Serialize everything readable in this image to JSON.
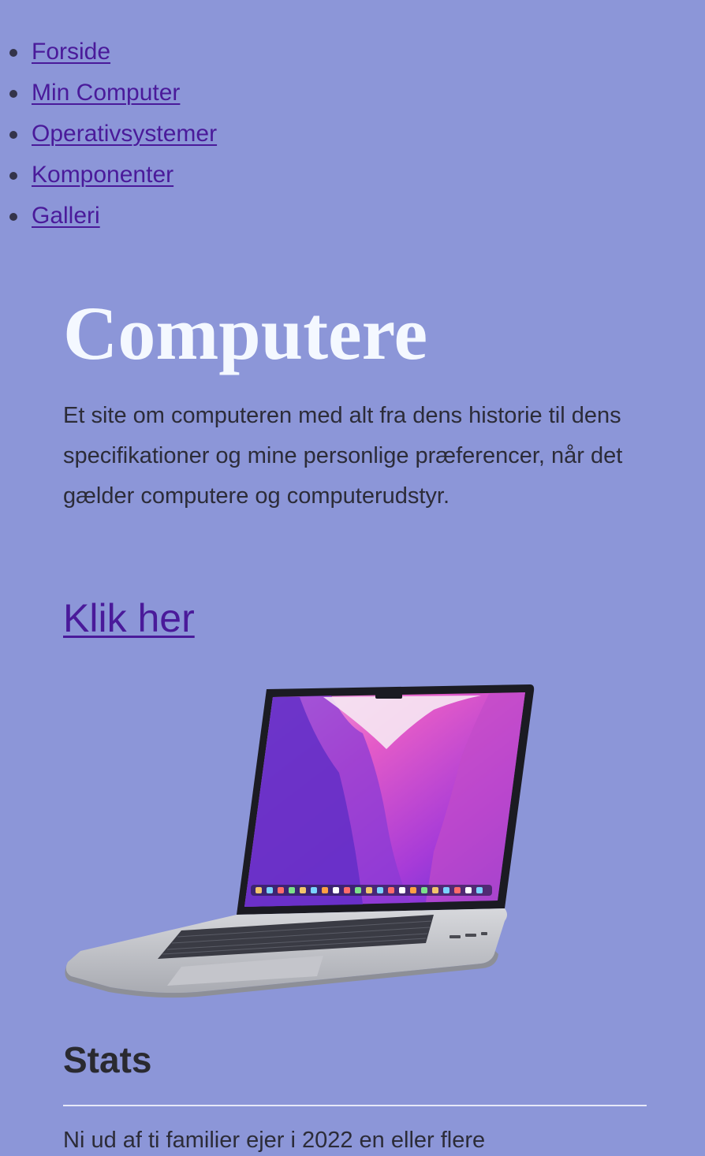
{
  "nav": {
    "items": [
      {
        "label": "Forside"
      },
      {
        "label": "Min Computer"
      },
      {
        "label": "Operativsystemer"
      },
      {
        "label": "Komponenter"
      },
      {
        "label": "Galleri"
      }
    ]
  },
  "hero": {
    "title": "Computere",
    "intro": "Et site om computeren med alt fra dens historie til dens specifikationer og mine personlige præferencer, når det gælder computere og computerudstyr.",
    "cta": "Klik her",
    "image_alt": "laptop"
  },
  "stats": {
    "heading": "Stats",
    "text": "Ni ud af ti familier ejer i 2022 en eller flere"
  },
  "colors": {
    "background": "#8c96d8",
    "link": "#4a1a9a",
    "title": "#f4f8ff"
  }
}
